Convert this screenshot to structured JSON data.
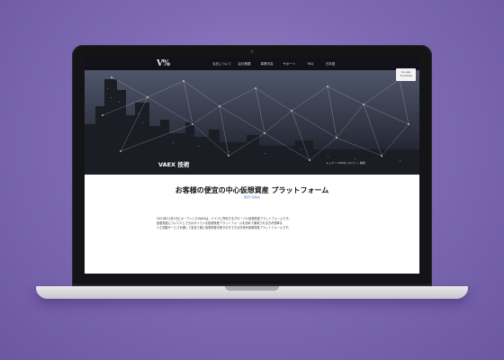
{
  "site": {
    "logo": "V%",
    "nav": [
      "当社について",
      "会社概要",
      "事業内容",
      "サポート",
      "FAQ",
      "日本語"
    ],
    "translate": {
      "line1": "Google",
      "line2": "Translate"
    }
  },
  "hero": {
    "title": "VAEX 技術",
    "breadcrumb": "トップ > VAEXについて > 技術"
  },
  "main": {
    "heading": "お客様の便宜の中心仮想資産 プラットフォーム",
    "subheading": "販売元連絡先",
    "paragraph": [
      "2021年11月1日にオープンしたVAEXは、ドイツに所在するグローバル仮想資産プラットフォームです。",
      "仮想資産について少しでもわかっている仮想資産プラットフォームを初めて使用される方が簡単な",
      "人工知能サービスを通して安全で楽に仮想資産を取り引きできる次世代仮想資産プラットフォームです。"
    ]
  },
  "colors": {
    "background": "#7f6ab4",
    "nav": "#121018",
    "link_accent": "#4a8bd6"
  }
}
